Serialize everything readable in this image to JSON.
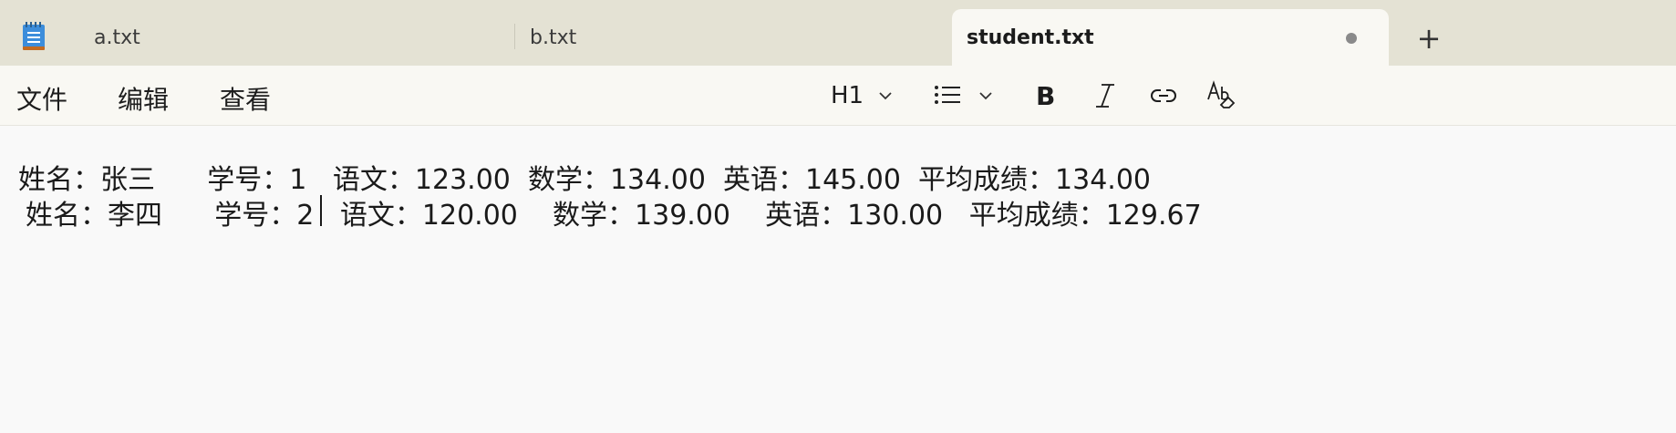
{
  "tabs": [
    {
      "label": "a.txt"
    },
    {
      "label": "b.txt"
    },
    {
      "label": "student.txt",
      "active": true,
      "unsaved": true
    }
  ],
  "new_tab_label": "+",
  "menu": {
    "file": "文件",
    "edit": "编辑",
    "view": "查看"
  },
  "toolbar": {
    "heading": "H1",
    "icons": [
      "heading-dropdown",
      "list-icon",
      "bold-icon",
      "italic-icon",
      "link-icon",
      "clear-formatting-icon"
    ]
  },
  "document": {
    "lines": [
      "姓名：张三      学号：1   语文：123.00  数学：134.00  英语：145.00  平均成绩：134.00",
      "姓名：李四      学号：2   语文：120.00    数学：139.00    英语：130.00   平均成绩：129.67"
    ]
  },
  "colors": {
    "tabbar": "#e4e2d4",
    "active_tab": "#f9f8f3",
    "editor": "#f9f9f9",
    "unsaved_dot": "#8a8a8a"
  }
}
